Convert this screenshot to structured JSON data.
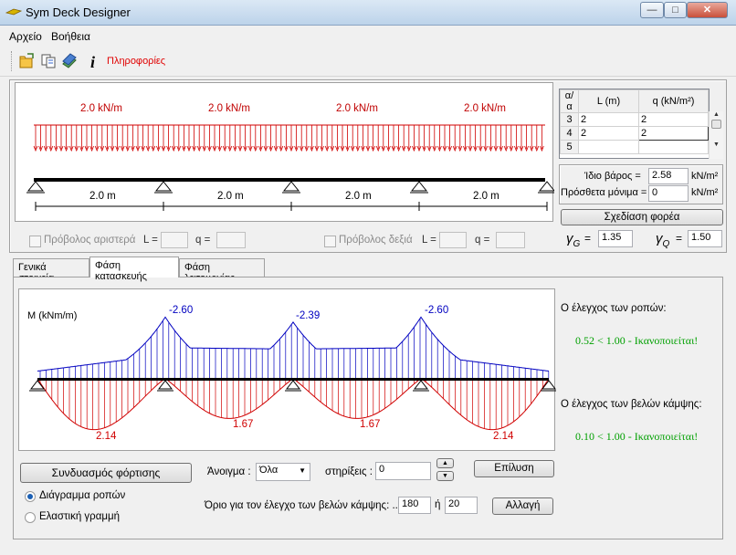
{
  "window": {
    "title": "Sym Deck Designer",
    "minimize": "—",
    "maximize": "□",
    "close": "✕"
  },
  "menu": [
    "Αρχείο",
    "Βοήθεια"
  ],
  "toolbar": {
    "info_label": "Πληροφορίες",
    "icons": [
      "open-file-icon",
      "copy-icon",
      "books-icon",
      "info-icon"
    ],
    "info_glyph": "i"
  },
  "loads": [
    {
      "value": 2.0,
      "label": "2.0 kN/m"
    },
    {
      "value": 2.0,
      "label": "2.0 kN/m"
    },
    {
      "value": 2.0,
      "label": "2.0 kN/m"
    },
    {
      "value": 2.0,
      "label": "2.0 kN/m"
    }
  ],
  "spans": [
    "2.0 m",
    "2.0 m",
    "2.0 m",
    "2.0 m"
  ],
  "cantilever_left": {
    "label": "Πρόβολος αριστερά",
    "L_label": "L =",
    "q_label": "q ="
  },
  "cantilever_right": {
    "label": "Πρόβολος δεξιά",
    "L_label": "L =",
    "q_label": "q ="
  },
  "table": {
    "headers": [
      "α/α",
      "L (m)",
      "q (kN/m²)"
    ],
    "rows": [
      {
        "n": "3",
        "L": "2",
        "q": "2"
      },
      {
        "n": "4",
        "L": "2",
        "q": "2"
      },
      {
        "n": "5",
        "L": "",
        "q": ""
      }
    ]
  },
  "self_weight": {
    "label": "Ίδιο βάρος =",
    "value": "2.58",
    "unit": "kN/m²"
  },
  "extra_permanent": {
    "label": "Πρόσθετα μόνιμα =",
    "value": "0",
    "unit": "kN/m²"
  },
  "design_button": "Σχεδίαση φορέα",
  "gamma_g": {
    "label": "γ",
    "sub": "G",
    "eq": "=",
    "value": "1.35"
  },
  "gamma_q": {
    "label": "γ",
    "sub": "Q",
    "eq": "=",
    "value": "1.50"
  },
  "tabs": [
    "Γενικά στοιχεία",
    "Φάση κατασκευής",
    "Φάση λειτουργίας"
  ],
  "moment_diagram": {
    "axis_label": "M (kNm/m)",
    "support_moments": [
      {
        "value": -2.6,
        "label": "-2.60"
      },
      {
        "value": -2.39,
        "label": "-2.39"
      },
      {
        "value": -2.6,
        "label": "-2.60"
      }
    ],
    "span_moments": [
      {
        "value": 2.14,
        "label": "2.14"
      },
      {
        "value": 1.67,
        "label": "1.67"
      },
      {
        "value": 1.67,
        "label": "1.67"
      },
      {
        "value": 2.14,
        "label": "2.14"
      }
    ]
  },
  "moment_check": {
    "title": "Ο έλεγχος των ροπών:",
    "result": "0.52 < 1.00 - Ικανοποιείται!"
  },
  "deflection_check": {
    "title": "Ο έλεγχος των βελών κάμψης:",
    "result": "0.10 < 1.00 - Ικανοποιείται!"
  },
  "load_combo_button": "Συνδυασμός φόρτισης",
  "radio_moment": "Διάγραμμα ροπών",
  "radio_elastic": "Ελαστική γραμμή",
  "span_select": {
    "label": "Άνοιγμα :",
    "value": "Όλα"
  },
  "supports": {
    "label": "στηρίξεις :",
    "value": "0"
  },
  "solve_button": "Επίλυση",
  "deflection_limit": {
    "label": "Όριο για τον έλεγχο των βελών κάμψης: ...",
    "value1": "180",
    "or": "ή",
    "value2": "20"
  },
  "change_button": "Αλλαγή",
  "colors": {
    "load": "#d00000",
    "negative": "#0000c0",
    "positive": "#d00000",
    "ok": "#00a000"
  }
}
